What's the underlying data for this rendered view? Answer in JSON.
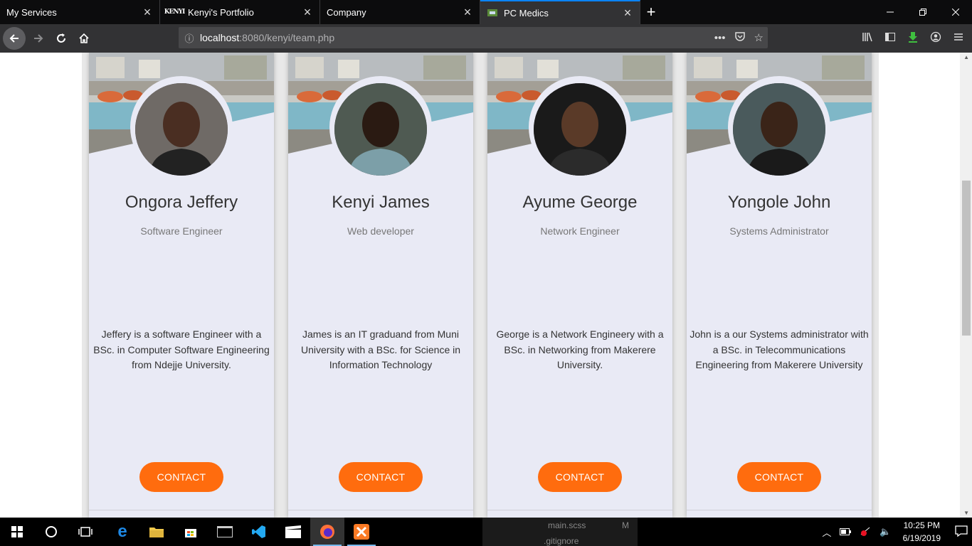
{
  "browser": {
    "tabs": [
      {
        "label": "My Services",
        "favicon": "none",
        "active": false
      },
      {
        "label": "Kenyi's Portfolio",
        "favicon": "KENYI",
        "active": false
      },
      {
        "label": "Company",
        "favicon": "none",
        "active": false
      },
      {
        "label": "PC Medics",
        "favicon": "pc-medics-icon",
        "active": true
      }
    ],
    "new_tab": "+",
    "url_host": "localhost",
    "url_rest": ":8080/kenyi/team.php",
    "page_actions": "•••",
    "accent": "#0a84ff"
  },
  "team": [
    {
      "name": "Ongora Jeffery",
      "role": "Software Engineer",
      "bio": "Jeffery is a software Engineer with a BSc. in Computer Software Engineering from Ndejje University.",
      "button": "CONTACT"
    },
    {
      "name": "Kenyi James",
      "role": "Web developer",
      "bio": "James is an IT graduand from Muni University with a BSc. for Science in Information Technology",
      "button": "CONTACT"
    },
    {
      "name": "Ayume George",
      "role": "Network Engineer",
      "bio": "George is a Network Engineery with a BSc. in Networking from Makerere University.",
      "button": "CONTACT"
    },
    {
      "name": "Yongole John",
      "role": "Systems Administrator",
      "bio": "John is a our Systems administrator with a BSc. in Telecommunications Engineering from Makerere University",
      "button": "CONTACT"
    }
  ],
  "colors": {
    "button": "#ff6c0e",
    "card": "#e9eaf5"
  },
  "taskbar": {
    "ghost_lines": [
      "main.scss",
      ".gitignore"
    ],
    "ghost_flag": "M",
    "time": "10:25 PM",
    "date": "6/19/2019"
  }
}
